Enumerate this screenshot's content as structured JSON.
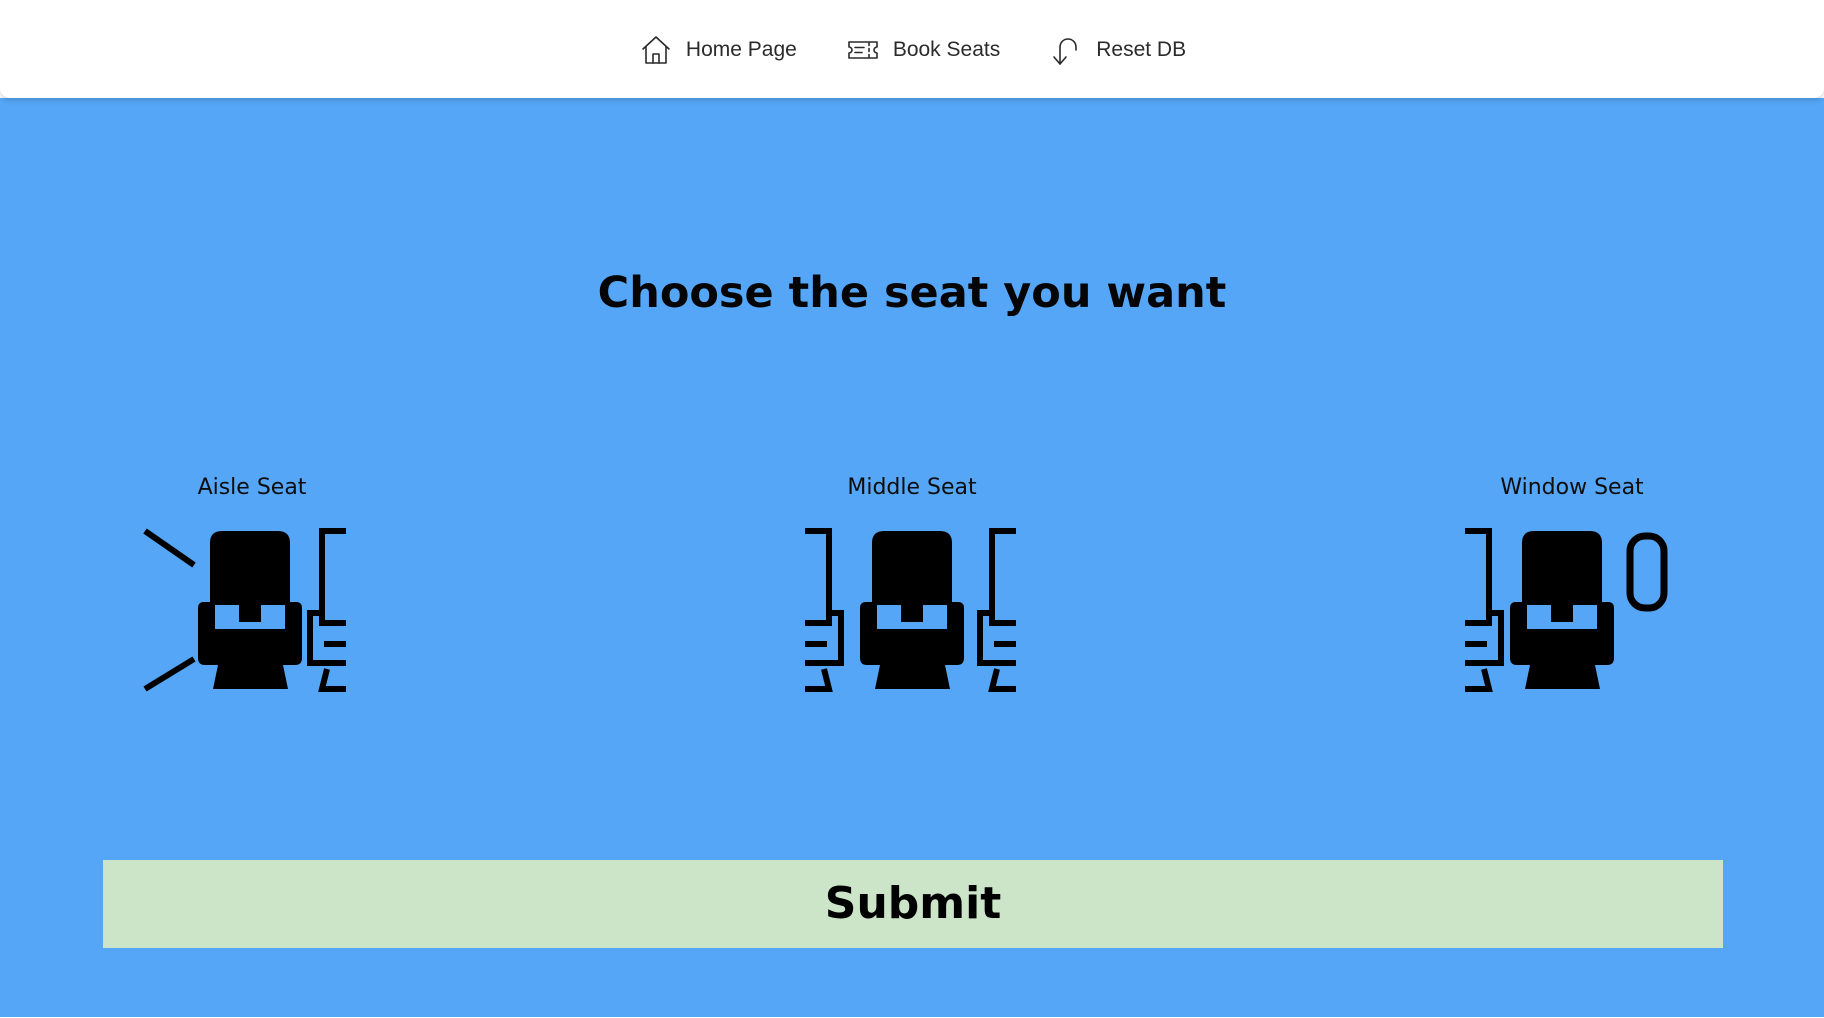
{
  "nav": {
    "items": [
      {
        "label": "Home Page",
        "icon": "home-icon"
      },
      {
        "label": "Book Seats",
        "icon": "ticket-icon"
      },
      {
        "label": "Reset DB",
        "icon": "undo-arrow-icon"
      }
    ]
  },
  "main": {
    "title": "Choose the seat you want",
    "seats": [
      {
        "label": "Aisle Seat",
        "icon": "aisle-seat-icon"
      },
      {
        "label": "Middle Seat",
        "icon": "middle-seat-icon"
      },
      {
        "label": "Window Seat",
        "icon": "window-seat-icon"
      }
    ],
    "submit_label": "Submit"
  },
  "colors": {
    "panel_background": "#55a6f7",
    "submit_background": "#cce5c9",
    "nav_background": "#ffffff",
    "icon_color": "#000000"
  }
}
